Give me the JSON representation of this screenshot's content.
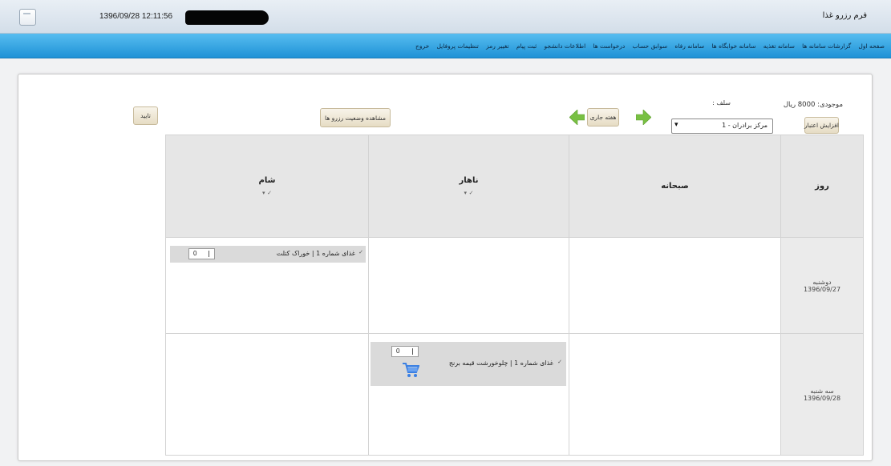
{
  "window": {
    "title": "فرم رزرو غذا",
    "datetime": "1396/09/28 12:11:56"
  },
  "nav": {
    "items": [
      "صفحه اول",
      "گزارشات سامانه ها",
      "سامانه تغذیه",
      "سامانه خوابگاه ها",
      "سامانه رفاه",
      "سوابق حساب",
      "درخواست ها",
      "اطلاعات دانشجو",
      "ثبت پیام",
      "تغییر رمز",
      "تنظیمات پروفایل",
      "خروج"
    ]
  },
  "controls": {
    "balance": "موجودی: 8000 ریال",
    "increase_credit": "افزایش اعتبار",
    "self_label": "سلف :",
    "self_selected": "مرکز برادران - 1",
    "current_week": "هفته جاری",
    "view_status": "مشاهده وضعیت رزرو ها",
    "confirm": "تایید"
  },
  "table": {
    "headers": {
      "day": "روز",
      "breakfast": "صبحانه",
      "lunch": "ناهار",
      "dinner": "شام"
    },
    "rows": [
      {
        "day_name": "دوشنبه",
        "date": "1396/09/27",
        "breakfast": null,
        "lunch": null,
        "dinner": {
          "label": "غذای شماره 1 | خوراک کتلت",
          "quantity": "0",
          "checked": true
        }
      },
      {
        "day_name": "سه شنبه",
        "date": "1396/09/28",
        "breakfast": null,
        "lunch": {
          "label": "غذای شماره 1 | چلوخورشت قیمه برنج",
          "quantity": "0",
          "checked": true,
          "in_cart": true
        },
        "dinner": null
      }
    ]
  },
  "icons": {
    "app": "app-window-icon",
    "next_week": "arrow-right-icon",
    "prev_week": "arrow-left-icon",
    "select": "chevron-down-icon",
    "checkbox": "checkbox-checked-icon",
    "cart": "shopping-cart-icon"
  },
  "colors": {
    "nav_blue": "#2a9fdf",
    "title_bar": "#dbe5ee",
    "button_beige": "#ece3cd",
    "arrow_green": "#78c043",
    "cart_blue": "#3a7fe3",
    "header_gray": "#e6e6e6",
    "food_cell_gray": "#dadada"
  }
}
